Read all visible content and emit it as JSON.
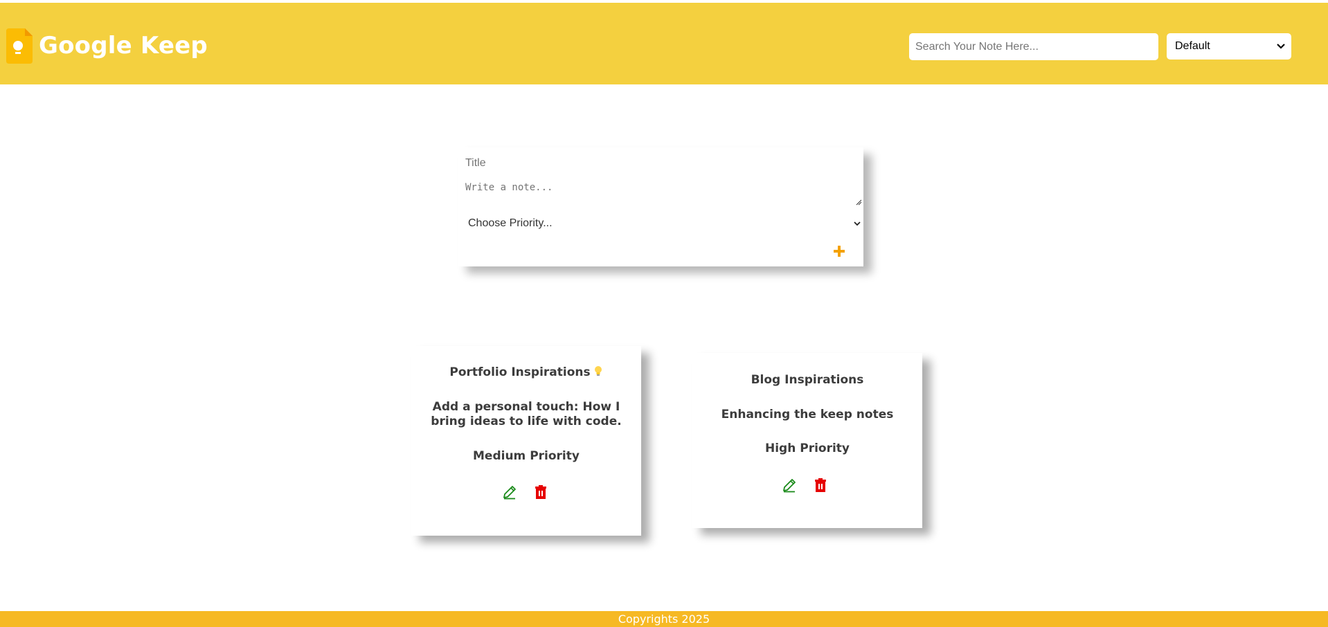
{
  "colors": {
    "header_bg": "#f4d03f",
    "footer_bg": "#f6b924",
    "add_icon": "#f4a100",
    "edit_icon": "#1a8a1a",
    "delete_icon": "#e60000",
    "logo_yellow": "#fbbc04"
  },
  "header": {
    "logo_icon": "keep-bulb-icon",
    "app_title": "Google Keep",
    "search_placeholder": "Search Your Note Here...",
    "sort_selected": "Default"
  },
  "creator": {
    "title_placeholder": "Title",
    "note_placeholder": "Write a note...",
    "priority_selected": "Choose Priority...",
    "add_icon": "plus-icon"
  },
  "notes": [
    {
      "title": "Portfolio Inspirations",
      "title_emoji": "lightbulb-emoji",
      "body": "Add a personal touch: How I bring ideas to life with code.",
      "priority": "Medium Priority"
    },
    {
      "title": "Blog Inspirations",
      "body": "Enhancing the keep notes",
      "priority": "High Priority"
    }
  ],
  "footer": {
    "text": "Copyrights 2025"
  }
}
